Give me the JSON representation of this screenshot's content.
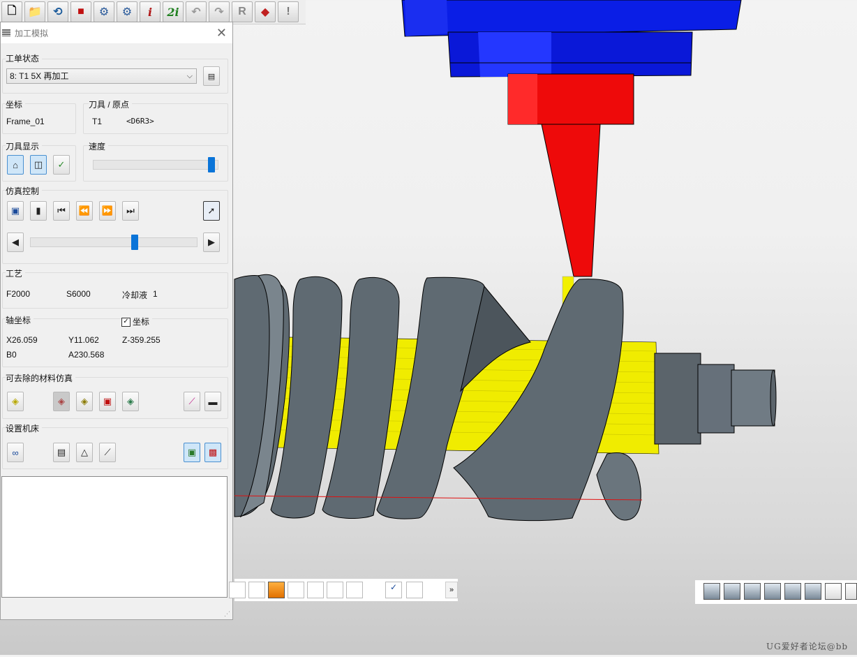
{
  "toolbar": {
    "items": [
      "new-icon",
      "open-icon",
      "save-icon",
      "gift-icon",
      "gear-icon",
      "gear-10-icon",
      "info-icon",
      "info-2-icon",
      "undo-icon",
      "redo-icon",
      "reset-icon",
      "cube-icon",
      "warning-icon"
    ],
    "info_label": "i",
    "info2_label": "2i",
    "reset_label": "R",
    "warning_label": "!"
  },
  "panel": {
    "title": "加工模拟",
    "job_status": {
      "label": "工单状态",
      "selected": "8: T1 5X 再加工"
    },
    "coordinate": {
      "label": "坐标",
      "value": "Frame_01"
    },
    "tool_origin": {
      "label": "刀具 / 原点",
      "tool": "T1",
      "name": "<D6R3>"
    },
    "tool_display": {
      "label": "刀具显示"
    },
    "speed": {
      "label": "速度",
      "value": 0.97
    },
    "sim_control": {
      "label": "仿真控制",
      "progress": 0.63
    },
    "process": {
      "label": "工艺",
      "feed": "F2000",
      "spindle": "S6000",
      "coolant_label": "冷却液",
      "coolant_value": "1"
    },
    "axis": {
      "label": "轴坐标",
      "coord_checkbox": "坐标",
      "x": "X26.059",
      "y": "Y11.062",
      "z": "Z-359.255",
      "b": "B0",
      "a": "A230.568"
    },
    "material": {
      "label": "可去除的材料仿真"
    },
    "machine": {
      "label": "设置机床"
    }
  },
  "bottom_toolbar": {
    "more_label": "»"
  },
  "watermark": "UG爱好者论坛@bb",
  "colors": {
    "spindle_blue": "#0a1ee6",
    "holder_red": "#ee0a0a",
    "tool_yellow": "#f2f000",
    "workpiece_gray": "#5f6a72",
    "accent": "#0a74d8"
  }
}
